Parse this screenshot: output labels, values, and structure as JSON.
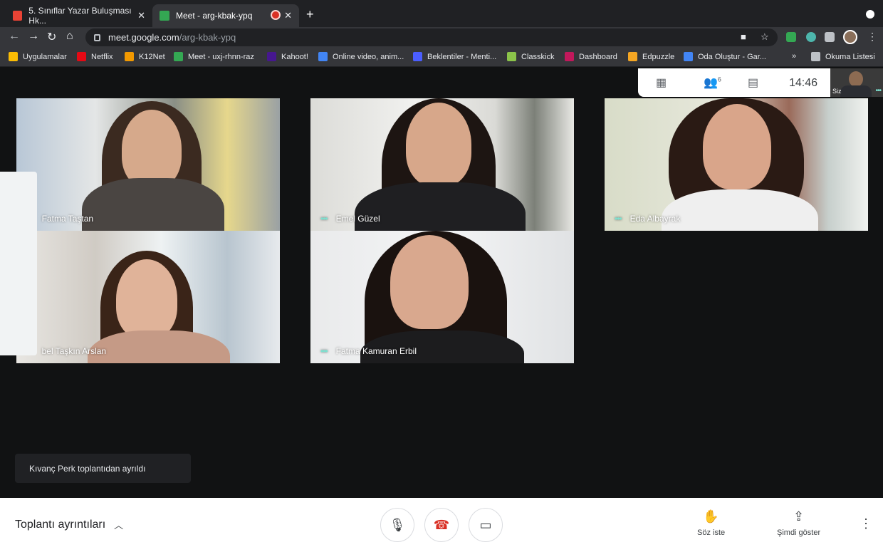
{
  "browser": {
    "tabs": [
      {
        "title": "5. Sınıflar Yazar Buluşması Hk...",
        "favicon_color": "#ea4335",
        "active": false
      },
      {
        "title": "Meet - arg-kbak-ypq",
        "favicon_color": "#34a853",
        "active": true
      }
    ],
    "url_host": "meet.google.com",
    "url_path": "/arg-kbak-ypq",
    "bookmarks": [
      {
        "label": "Uygulamalar",
        "color": "#fbbc04"
      },
      {
        "label": "Netflix",
        "color": "#e50914"
      },
      {
        "label": "K12Net",
        "color": "#f29900"
      },
      {
        "label": "Meet - uxj-rhnn-raz",
        "color": "#34a853"
      },
      {
        "label": "Kahoot!",
        "color": "#46178f"
      },
      {
        "label": "Online video, anim...",
        "color": "#4285f4"
      },
      {
        "label": "Beklentiler - Menti...",
        "color": "#4b5eff"
      },
      {
        "label": "Classkick",
        "color": "#8bc34a"
      },
      {
        "label": "Dashboard",
        "color": "#c2185b"
      },
      {
        "label": "Edpuzzle",
        "color": "#f5a623"
      },
      {
        "label": "Oda Oluştur - Gar...",
        "color": "#4285f4"
      }
    ],
    "bookmarks_overflow": "»",
    "reading_list": "Okuma Listesi"
  },
  "meet": {
    "time": "14:46",
    "participant_count": "6",
    "self_label": "Siz",
    "participants": [
      {
        "name": "Fatma Taştan",
        "shown_name": "Fatma Taştan"
      },
      {
        "name": "Emel Güzel",
        "shown_name": "Emel Güzel"
      },
      {
        "name": "Eda Albayrak",
        "shown_name": "Eda Albayrak"
      },
      {
        "name": "...bel Taşkın Arslan",
        "shown_name": "bel Taşkın Arslan"
      },
      {
        "name": "Fatma Kamuran Erbil",
        "shown_name": "Fatma Kamuran Erbil"
      }
    ],
    "toast": "Kıvanç Perk toplantıdan ayrıldı",
    "details_label": "Toplantı ayrıntıları",
    "raise_hand_label": "Söz iste",
    "present_label": "Şimdi göster",
    "accent": "#7de2d1",
    "hangup_color": "#d93025"
  }
}
